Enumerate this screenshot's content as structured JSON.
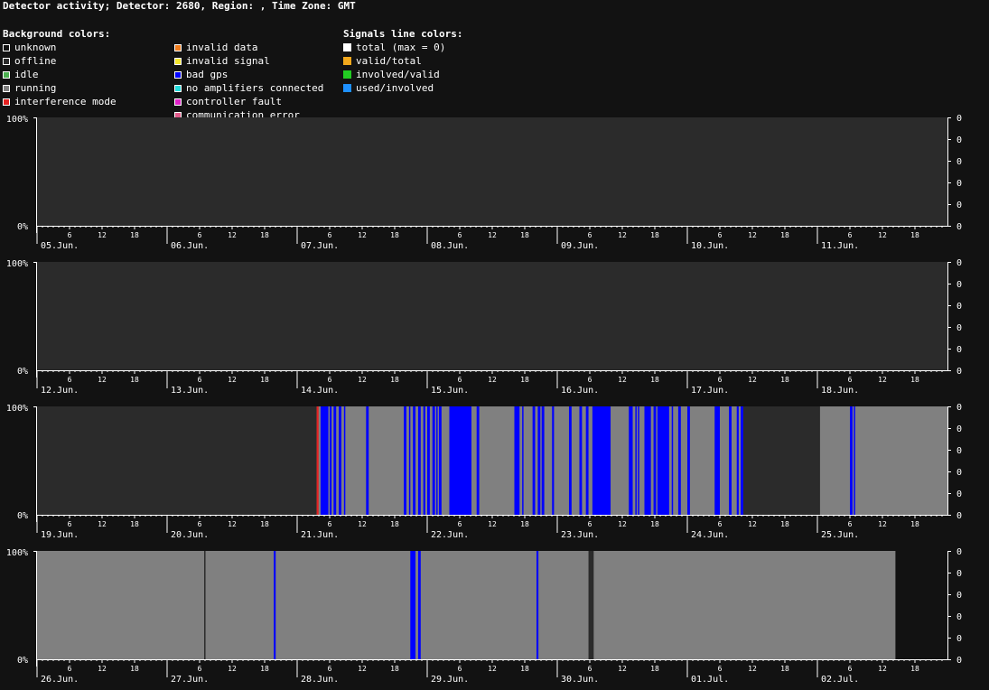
{
  "title": "Detector activity; Detector: 2680, Region: , Time Zone: GMT",
  "legend": {
    "background_header": "Background colors:",
    "signals_header": "Signals line colors:",
    "background_col1": [
      {
        "label": "unknown",
        "color": "#121212"
      },
      {
        "label": "offline",
        "color": "#2b2b2b"
      },
      {
        "label": "idle",
        "color": "#4caf50"
      },
      {
        "label": "running",
        "color": "#808080"
      },
      {
        "label": "interference mode",
        "color": "#e52222"
      }
    ],
    "background_col2": [
      {
        "label": "invalid data",
        "color": "#f07c1c"
      },
      {
        "label": "invalid signal",
        "color": "#f2e52c"
      },
      {
        "label": "bad gps",
        "color": "#0000ff"
      },
      {
        "label": "no amplifiers connected",
        "color": "#22dcdc"
      },
      {
        "label": "controller fault",
        "color": "#e020c8"
      },
      {
        "label": "communication error",
        "color": "#e25a8a"
      }
    ],
    "signals": [
      {
        "label": "total (max = 0)",
        "color": "#ffffff"
      },
      {
        "label": "valid/total",
        "color": "#f2a81c"
      },
      {
        "label": "involved/valid",
        "color": "#22cc22"
      },
      {
        "label": "used/involved",
        "color": "#1e90ff"
      }
    ]
  },
  "chart_data": {
    "type": "timeline",
    "colors": {
      "offline": "#2b2b2b",
      "running": "#808080",
      "bad_gps": "#0000ff",
      "interference": "#e52222"
    },
    "y_left_labels": {
      "top": "100%",
      "bottom": "0%"
    },
    "y_right_labels": [
      "0",
      "0",
      "0",
      "0",
      "0",
      "0"
    ],
    "hour_ticks": [
      "6",
      "12",
      "18"
    ],
    "rows": [
      {
        "days": [
          "05.Jun.",
          "06.Jun.",
          "07.Jun.",
          "08.Jun.",
          "09.Jun.",
          "10.Jun.",
          "11.Jun."
        ],
        "segments": [
          {
            "start": 0,
            "end": 7,
            "status": "offline"
          }
        ]
      },
      {
        "days": [
          "12.Jun.",
          "13.Jun.",
          "14.Jun.",
          "15.Jun.",
          "16.Jun.",
          "17.Jun.",
          "18.Jun."
        ],
        "segments": [
          {
            "start": 0,
            "end": 7,
            "status": "offline"
          }
        ]
      },
      {
        "days": [
          "19.Jun.",
          "20.Jun.",
          "21.Jun.",
          "22.Jun.",
          "23.Jun.",
          "24.Jun.",
          "25.Jun."
        ],
        "segments": [
          {
            "start": 0,
            "end": 2.15,
            "status": "offline"
          },
          {
            "start": 2.15,
            "end": 5.43,
            "status": "running"
          },
          {
            "start": 5.43,
            "end": 6.02,
            "status": "offline"
          },
          {
            "start": 6.02,
            "end": 7,
            "status": "running"
          },
          {
            "start": 2.15,
            "end": 2.165,
            "status": "interference"
          },
          {
            "start": 2.18,
            "end": 2.24,
            "status": "bad_gps"
          },
          {
            "start": 2.25,
            "end": 2.265,
            "status": "bad_gps"
          },
          {
            "start": 2.28,
            "end": 2.3,
            "status": "bad_gps"
          },
          {
            "start": 2.32,
            "end": 2.34,
            "status": "bad_gps"
          },
          {
            "start": 2.36,
            "end": 2.37,
            "status": "bad_gps"
          },
          {
            "start": 2.53,
            "end": 2.55,
            "status": "bad_gps"
          },
          {
            "start": 2.82,
            "end": 2.84,
            "status": "bad_gps"
          },
          {
            "start": 2.86,
            "end": 2.87,
            "status": "bad_gps"
          },
          {
            "start": 2.89,
            "end": 2.91,
            "status": "bad_gps"
          },
          {
            "start": 2.93,
            "end": 2.95,
            "status": "bad_gps"
          },
          {
            "start": 2.97,
            "end": 2.985,
            "status": "bad_gps"
          },
          {
            "start": 3.0,
            "end": 3.02,
            "status": "bad_gps"
          },
          {
            "start": 3.04,
            "end": 3.06,
            "status": "bad_gps"
          },
          {
            "start": 3.07,
            "end": 3.08,
            "status": "bad_gps"
          },
          {
            "start": 3.09,
            "end": 3.11,
            "status": "bad_gps"
          },
          {
            "start": 3.17,
            "end": 3.34,
            "status": "bad_gps"
          },
          {
            "start": 3.38,
            "end": 3.4,
            "status": "bad_gps"
          },
          {
            "start": 3.67,
            "end": 3.71,
            "status": "bad_gps"
          },
          {
            "start": 3.73,
            "end": 3.74,
            "status": "bad_gps"
          },
          {
            "start": 3.81,
            "end": 3.83,
            "status": "bad_gps"
          },
          {
            "start": 3.85,
            "end": 3.87,
            "status": "bad_gps"
          },
          {
            "start": 3.88,
            "end": 3.9,
            "status": "bad_gps"
          },
          {
            "start": 3.96,
            "end": 3.975,
            "status": "bad_gps"
          },
          {
            "start": 4.09,
            "end": 4.11,
            "status": "bad_gps"
          },
          {
            "start": 4.17,
            "end": 4.19,
            "status": "bad_gps"
          },
          {
            "start": 4.22,
            "end": 4.24,
            "status": "bad_gps"
          },
          {
            "start": 4.27,
            "end": 4.41,
            "status": "bad_gps"
          },
          {
            "start": 4.55,
            "end": 4.58,
            "status": "bad_gps"
          },
          {
            "start": 4.6,
            "end": 4.61,
            "status": "bad_gps"
          },
          {
            "start": 4.62,
            "end": 4.63,
            "status": "bad_gps"
          },
          {
            "start": 4.67,
            "end": 4.72,
            "status": "bad_gps"
          },
          {
            "start": 4.74,
            "end": 4.76,
            "status": "bad_gps"
          },
          {
            "start": 4.77,
            "end": 4.86,
            "status": "bad_gps"
          },
          {
            "start": 4.88,
            "end": 4.89,
            "status": "bad_gps"
          },
          {
            "start": 4.93,
            "end": 4.95,
            "status": "bad_gps"
          },
          {
            "start": 5.0,
            "end": 5.02,
            "status": "bad_gps"
          },
          {
            "start": 5.21,
            "end": 5.25,
            "status": "bad_gps"
          },
          {
            "start": 5.32,
            "end": 5.34,
            "status": "bad_gps"
          },
          {
            "start": 5.38,
            "end": 5.395,
            "status": "bad_gps"
          },
          {
            "start": 5.41,
            "end": 5.43,
            "status": "bad_gps"
          },
          {
            "start": 6.25,
            "end": 6.27,
            "status": "bad_gps"
          },
          {
            "start": 6.28,
            "end": 6.29,
            "status": "bad_gps"
          }
        ]
      },
      {
        "days": [
          "26.Jun.",
          "27.Jun.",
          "28.Jun.",
          "29.Jun.",
          "30.Jun.",
          "01.Jul.",
          "02.Jul."
        ],
        "segments": [
          {
            "start": 0,
            "end": 6.6,
            "status": "running"
          },
          {
            "start": 1.285,
            "end": 1.292,
            "status": "offline"
          },
          {
            "start": 1.82,
            "end": 1.835,
            "status": "bad_gps"
          },
          {
            "start": 2.87,
            "end": 2.91,
            "status": "bad_gps"
          },
          {
            "start": 2.93,
            "end": 2.95,
            "status": "bad_gps"
          },
          {
            "start": 3.84,
            "end": 3.855,
            "status": "bad_gps"
          },
          {
            "start": 4.24,
            "end": 4.28,
            "status": "offline"
          }
        ]
      }
    ]
  }
}
